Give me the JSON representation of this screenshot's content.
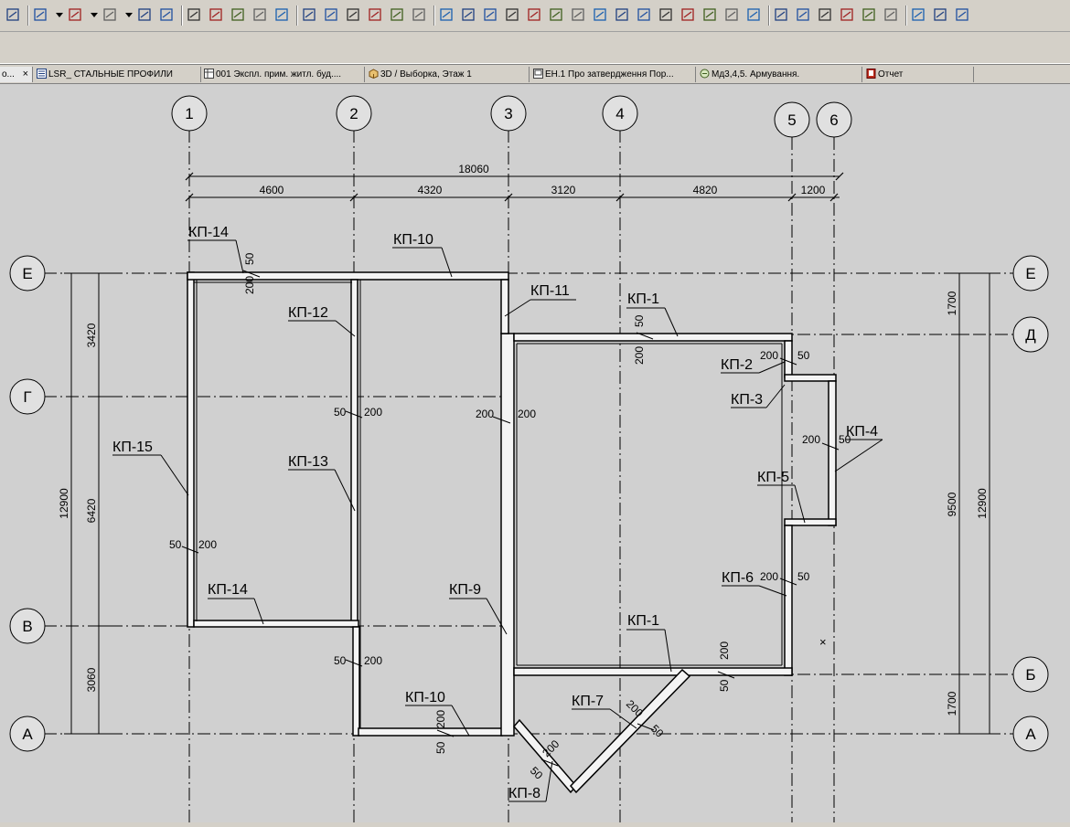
{
  "toolbar": {
    "icons": [
      "undo-icon",
      "arrow-select-icon",
      "dropdown-icon",
      "tool-icon",
      "dropdown-icon",
      "grid-dots-icon",
      "dropdown-icon",
      "pencil-settings-icon",
      "table-icon",
      "red-arrow-icon",
      "text-icon",
      "corner-icon",
      "arc-icon",
      "cube-icon",
      "document-red-icon",
      "layers-icon",
      "stack-icon",
      "bridge-icon",
      "window-icon",
      "hatch-icon",
      "node-icon",
      "node2-icon",
      "node3-icon",
      "node4-icon",
      "node5-icon",
      "node6-icon",
      "up-icon",
      "down-icon",
      "move-icon",
      "rotate-icon",
      "mirror-icon",
      "lock-icon",
      "group-icon",
      "magnify-icon",
      "snap-icon",
      "view1-icon",
      "view2-icon",
      "view3-icon",
      "view4-icon",
      "view5-icon",
      "camera-icon",
      "floor-plan-icon",
      "section-icon",
      "elevation-icon"
    ]
  },
  "tabs": [
    {
      "label": "о...",
      "icon": "document-icon",
      "close": "×",
      "active": true
    },
    {
      "label": "LSR_ СТАЛЬНЫЕ ПРОФИЛИ",
      "icon": "list-icon"
    },
    {
      "label": "001 Экспл. прим. житл. буд....",
      "icon": "table-icon"
    },
    {
      "label": "3D / Выборка, Этаж 1",
      "icon": "3d-box-icon"
    },
    {
      "label": "ЕН.1 Про затвердження Пор...",
      "icon": "layout-icon"
    },
    {
      "label": "Мд3,4,5. Армування.",
      "icon": "detail-icon"
    },
    {
      "label": "Отчет",
      "icon": "report-icon"
    }
  ],
  "drawing": {
    "axes_top": [
      "1",
      "2",
      "3",
      "4",
      "5",
      "6"
    ],
    "axes_side": [
      "Е",
      "Д",
      "Г",
      "В",
      "Б",
      "А"
    ],
    "dim_total_top": "18060",
    "dims_top": [
      "4600",
      "4320",
      "3120",
      "4820",
      "1200"
    ],
    "dims_left_inner": [
      "3420",
      "6420",
      "3060"
    ],
    "dim_left_total": "12900",
    "dims_right_inner": [
      "1700",
      "9500",
      "1700"
    ],
    "dim_right_total": "12900",
    "marks": {
      "kp14_top": "КП-14",
      "kp10_top": "КП-10",
      "kp11": "КП-11",
      "kp1_top": "КП-1",
      "kp12": "КП-12",
      "kp2": "КП-2",
      "kp3": "КП-3",
      "kp4": "КП-4",
      "kp15": "КП-15",
      "kp13": "КП-13",
      "kp5": "КП-5",
      "kp6": "КП-6",
      "kp14_bottom": "КП-14",
      "kp9": "КП-9",
      "kp1_bottom": "КП-1",
      "kp10_bottom": "КП-10",
      "kp7": "КП-7",
      "kp8": "КП-8"
    },
    "offset_50": "50",
    "offset_200": "200",
    "cursor_mark": "×"
  }
}
